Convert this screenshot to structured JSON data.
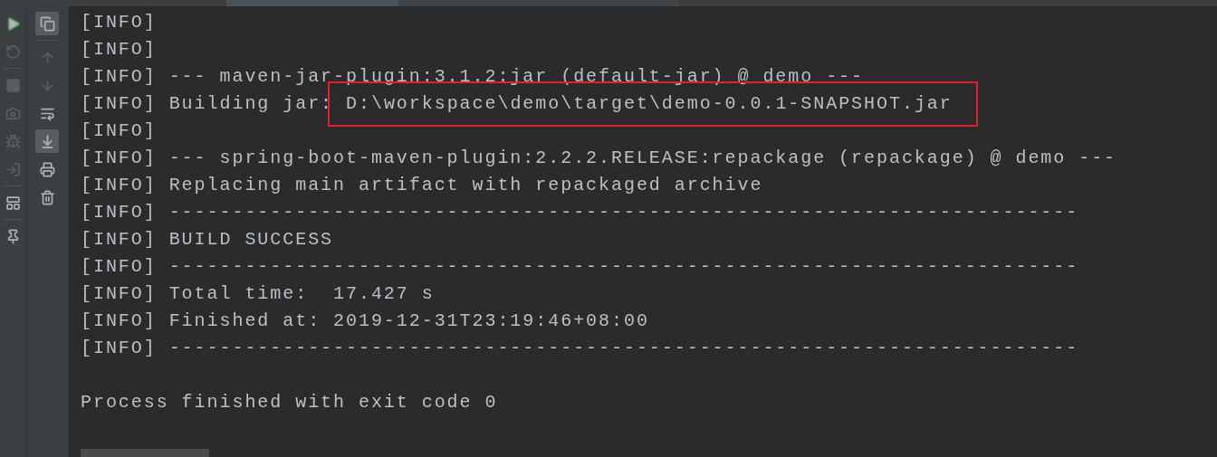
{
  "left_toolbar": [
    {
      "selected": false,
      "disabled": false
    },
    {
      "selected": false,
      "disabled": true
    },
    {
      "selected": false,
      "disabled": true
    },
    {
      "selected": false,
      "disabled": true
    },
    {
      "selected": false,
      "disabled": true
    },
    {
      "selected": false,
      "disabled": true
    },
    {
      "selected": false,
      "disabled": false
    },
    {
      "selected": false,
      "disabled": false
    }
  ],
  "console_toolbar": [
    {
      "selected": true,
      "disabled": false
    },
    {
      "selected": false,
      "disabled": true
    },
    {
      "selected": false,
      "disabled": true
    },
    {
      "selected": false,
      "disabled": false
    },
    {
      "selected": true,
      "disabled": false
    },
    {
      "selected": false,
      "disabled": false
    },
    {
      "selected": false,
      "disabled": false
    }
  ],
  "console": {
    "lines": [
      {
        "text": "[INFO]"
      },
      {
        "text": "[INFO]"
      },
      {
        "text": "[INFO] --- maven-jar-plugin:3.1.2:jar (default-jar) @ demo ---"
      },
      {
        "text": "[INFO] Building jar:",
        "highlight": "D:\\workspace\\demo\\target\\demo-0.0.1-SNAPSHOT.jar"
      },
      {
        "text": "[INFO]"
      },
      {
        "text": "[INFO] --- spring-boot-maven-plugin:2.2.2.RELEASE:repackage (repackage) @ demo ---"
      },
      {
        "text": "[INFO] Replacing main artifact with repackaged archive"
      },
      {
        "text": "[INFO] ------------------------------------------------------------------------"
      },
      {
        "text": "[INFO] BUILD SUCCESS"
      },
      {
        "text": "[INFO] ------------------------------------------------------------------------"
      },
      {
        "text": "[INFO] Total time:  17.427 s"
      },
      {
        "text": "[INFO] Finished at: 2019-12-31T23:19:46+08:00"
      },
      {
        "text": "[INFO] ------------------------------------------------------------------------"
      }
    ],
    "exit_message": "Process finished with exit code 0"
  }
}
